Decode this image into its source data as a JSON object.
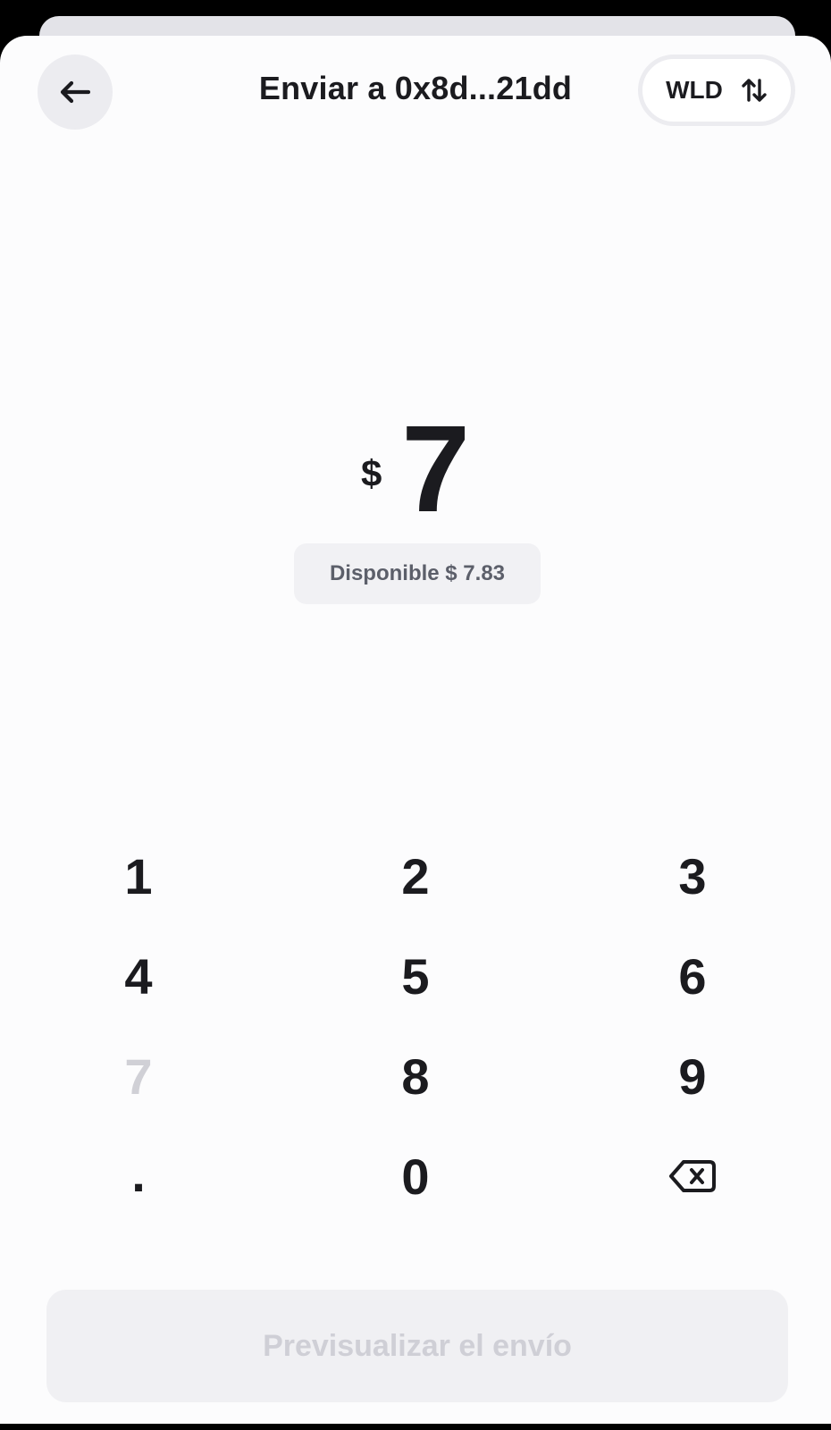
{
  "header": {
    "title": "Enviar a 0x8d...21dd",
    "back_icon": "arrow-left-icon",
    "currency_toggle": {
      "label": "WLD",
      "icon": "swap-vertical-icon"
    }
  },
  "amount": {
    "symbol": "$",
    "value": "7"
  },
  "available": {
    "text": "Disponible $ 7.83"
  },
  "keypad": {
    "keys": [
      "1",
      "2",
      "3",
      "4",
      "5",
      "6",
      "7",
      "8",
      "9",
      ".",
      "0"
    ],
    "backspace_icon": "backspace-icon",
    "disabled_keys": [
      "7"
    ]
  },
  "footer": {
    "preview_label": "Previsualizar el envío"
  },
  "colors": {
    "sheet_background": "#fcfcfd",
    "text_primary": "#1b1b1f",
    "text_secondary": "#5c5f6a",
    "disabled_text": "#cfcfd6",
    "pill_background": "#f1f1f4"
  }
}
